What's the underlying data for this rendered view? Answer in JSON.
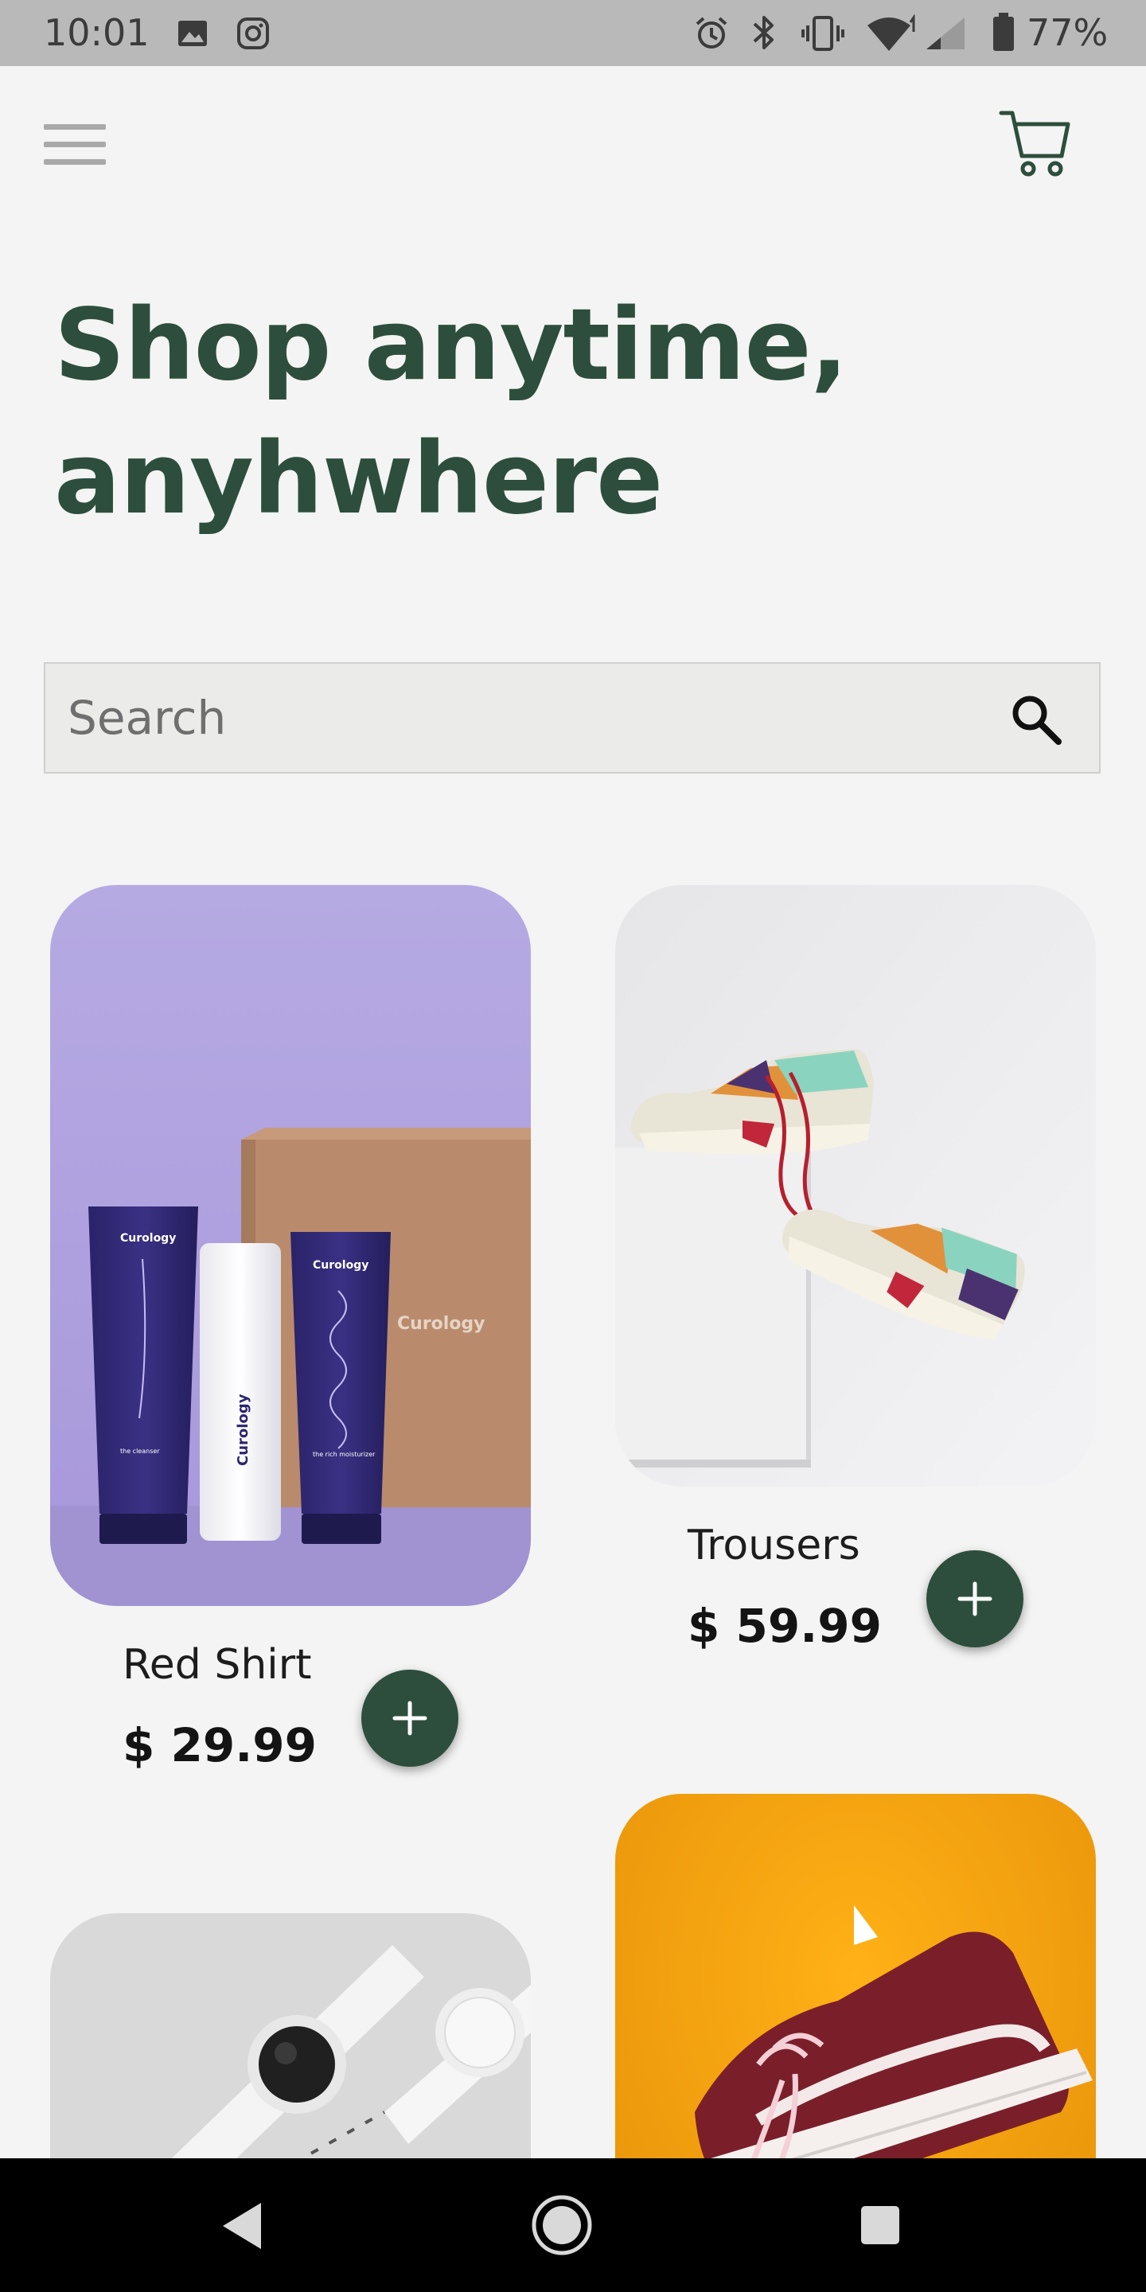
{
  "status_bar": {
    "time": "10:01",
    "battery": "77%",
    "left_icons": [
      "image-icon",
      "instagram-icon"
    ],
    "right_icons": [
      "alarm-icon",
      "bluetooth-icon",
      "vibrate-icon",
      "wifi-icon",
      "signal-icon",
      "battery-icon"
    ]
  },
  "header": {
    "menu_icon": "hamburger-menu-icon",
    "cart_icon": "shopping-cart-icon"
  },
  "title": {
    "line1": "Shop anytime,",
    "line2": "anyhwhere"
  },
  "search": {
    "placeholder": "Search",
    "value": "",
    "icon": "search-icon"
  },
  "products": [
    {
      "name": "Red Shirt",
      "price": "$ 29.99",
      "image": "skincare-products-photo"
    },
    {
      "name": "Trousers",
      "price": "$ 59.99",
      "image": "sneakers-photo"
    },
    {
      "name": "",
      "price": "",
      "image": "smartwatch-photo"
    },
    {
      "name": "",
      "price": "",
      "image": "maroon-sneaker-photo"
    }
  ],
  "navigation": {
    "back_icon": "back-triangle-icon",
    "home_icon": "home-circle-icon",
    "recents_icon": "recents-square-icon"
  },
  "colors": {
    "accent": "#2d4e3c",
    "background": "#f3f4f3",
    "status_bar": "#b9b9b9",
    "nav_bar": "#000000"
  }
}
